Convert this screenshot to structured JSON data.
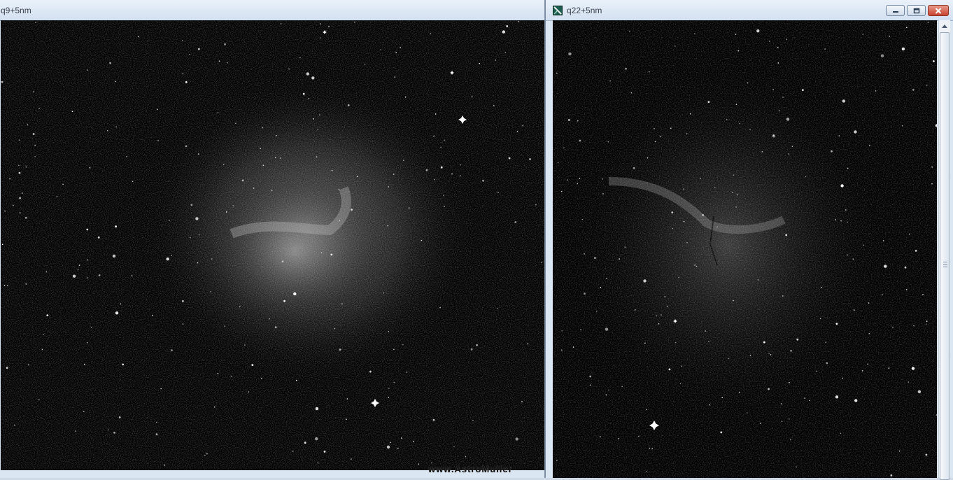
{
  "windows": {
    "left": {
      "title": "q9+5nm"
    },
    "right": {
      "title": "q22+5nm",
      "controls": [
        "minimize-icon",
        "restore-icon",
        "close-icon"
      ]
    }
  },
  "watermark": "www.AstroMuller",
  "colors": {
    "titlebar": "#dbe6f3",
    "close_button": "#c8432f",
    "image_background": "#000000"
  }
}
